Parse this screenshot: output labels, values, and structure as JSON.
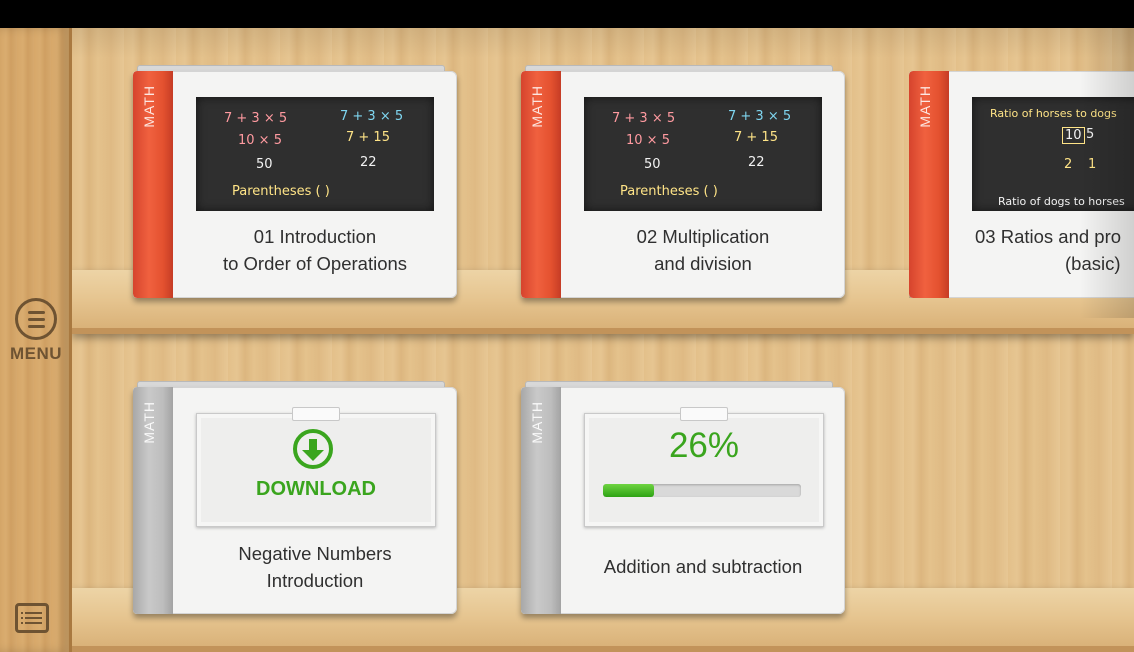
{
  "sidebar": {
    "menu_label": "MENU",
    "menu_icon": "hamburger-circle-icon",
    "list_icon": "list-icon"
  },
  "books": [
    {
      "spine_label": "MATH",
      "spine_color": "#e8553a",
      "title_line1": "01 Introduction",
      "title_line2": "to Order of Operations",
      "state": "downloaded",
      "board": {
        "lines": [
          "7 + 3 × 5",
          "10 × 5",
          "50",
          "7 + 3 × 5",
          "7 + 15",
          "22",
          "Parentheses  (  )"
        ]
      }
    },
    {
      "spine_label": "MATH",
      "spine_color": "#e8553a",
      "title_line1": "02 Multiplication",
      "title_line2": "and division",
      "state": "downloaded",
      "board": {
        "lines": [
          "7 + 3 × 5",
          "10 × 5",
          "50",
          "7 + 3 × 5",
          "7 + 15",
          "22",
          "Parentheses  (  )"
        ]
      }
    },
    {
      "spine_label": "MATH",
      "spine_color": "#e8553a",
      "title_line1": "03 Ratios and pro",
      "title_line2": "(basic)",
      "state": "downloaded",
      "board": {
        "lines": [
          "Ratio of horses to dogs",
          "10",
          "5",
          "2",
          "1",
          "Ratio of dogs to horses"
        ]
      }
    },
    {
      "spine_label": "MATH",
      "spine_color": "#b8b8b8",
      "title_line1": "Negative Numbers",
      "title_line2": "Introduction",
      "state": "available",
      "download_label": "DOWNLOAD"
    },
    {
      "spine_label": "MATH",
      "spine_color": "#b8b8b8",
      "title_line1": "Addition and subtraction",
      "title_line2": "",
      "state": "downloading",
      "progress_label": "26%",
      "progress": 0.26
    }
  ],
  "colors": {
    "accent_green": "#3aa51e",
    "spine_red": "#e8553a",
    "spine_grey": "#b8b8b8"
  }
}
